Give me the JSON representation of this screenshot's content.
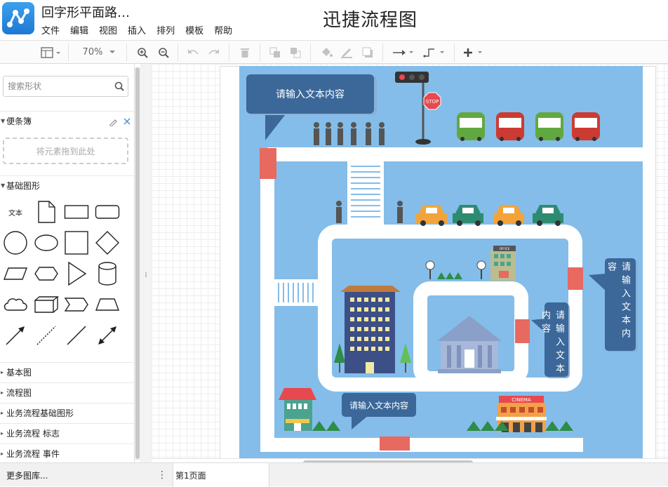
{
  "header": {
    "doc_title": "回字形平面路…",
    "app_title": "迅捷流程图",
    "menu": [
      "文件",
      "编辑",
      "视图",
      "插入",
      "排列",
      "模板",
      "帮助"
    ]
  },
  "toolbar": {
    "zoom": "70%"
  },
  "sidebar": {
    "search_placeholder": "搜索形状",
    "scratchpad": {
      "title": "便条簿",
      "drop_hint": "将元素拖到此处"
    },
    "basic": {
      "title": "基础图形",
      "text_shape": "文本"
    },
    "libraries": [
      "基本图",
      "流程图",
      "业务流程基础图形",
      "业务流程 标志",
      "业务流程 事件"
    ],
    "more": "更多图库..."
  },
  "diagram": {
    "callouts": [
      "请输入文本内容",
      "请输入文本内容",
      "请输入文本内容",
      "请输入文本内容"
    ],
    "stop_sign": "STOP",
    "cinema_sign": "CINEMA",
    "office_sign": "OFFICE"
  },
  "pages": {
    "tab": "第1页面"
  },
  "colors": {
    "map_bg": "#84bde9",
    "road": "#ffffff",
    "callout": "#3b6899",
    "marker": "#e8695f"
  }
}
